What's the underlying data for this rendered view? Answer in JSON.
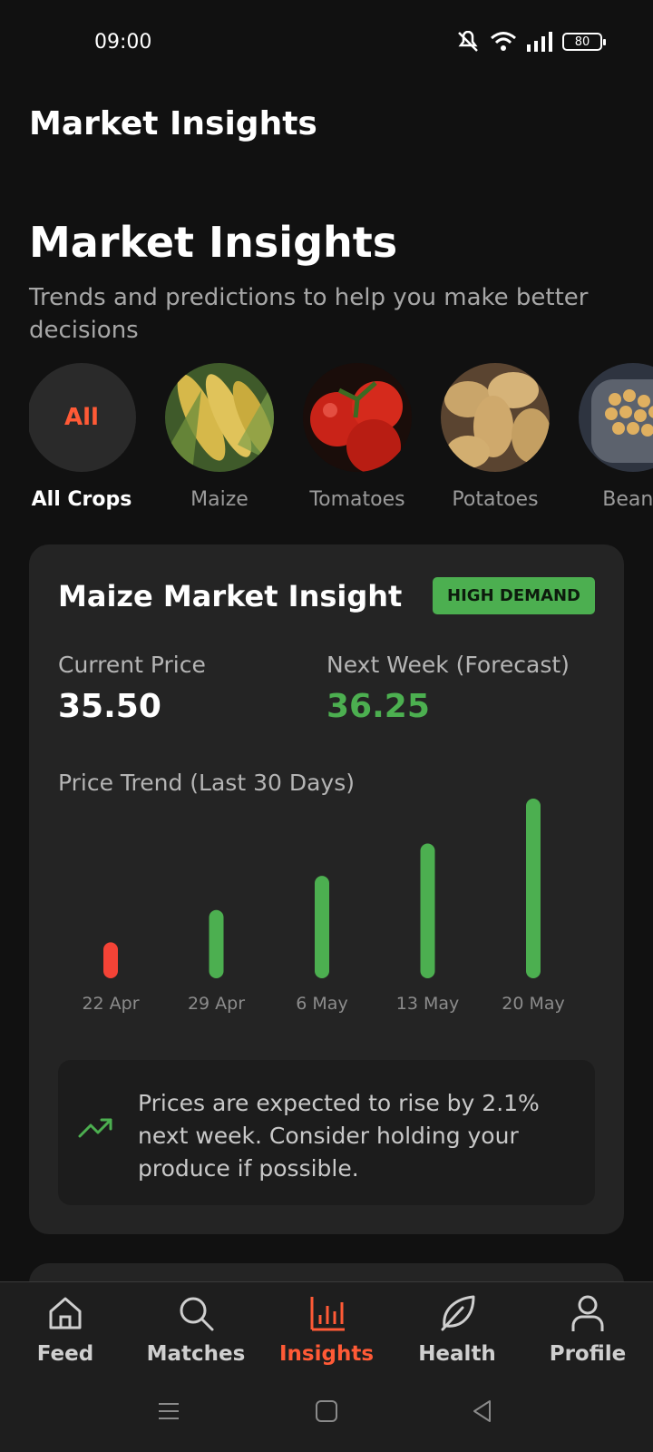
{
  "status": {
    "time": "09:00",
    "battery": "80"
  },
  "app_title": "Market Insights",
  "hero": {
    "title": "Market Insights",
    "subtitle": "Trends and predictions to help you make better decisions"
  },
  "crops": [
    {
      "label": "All Crops",
      "badge": "All",
      "active": true
    },
    {
      "label": "Maize"
    },
    {
      "label": "Tomatoes"
    },
    {
      "label": "Potatoes"
    },
    {
      "label": "Beans"
    }
  ],
  "card": {
    "title": "Maize Market Insight",
    "badge": "HIGH DEMAND",
    "current_label": "Current Price",
    "current_value": "35.50",
    "forecast_label": "Next Week (Forecast)",
    "forecast_value": "36.25",
    "trend_label": "Price Trend (Last 30 Days)",
    "note": "Prices are expected to rise by 2.1% next week. Consider holding your produce if possible."
  },
  "chart_data": {
    "type": "bar",
    "categories": [
      "22 Apr",
      "29 Apr",
      "6 May",
      "13 May",
      "20 May"
    ],
    "values": [
      0.2,
      0.38,
      0.57,
      0.75,
      1.0
    ],
    "colors": [
      "#f44336",
      "#4caf50",
      "#4caf50",
      "#4caf50",
      "#4caf50"
    ]
  },
  "colors": {
    "accent": "#ff5a36",
    "positive": "#4caf50",
    "negative": "#f44336"
  },
  "nav": {
    "items": [
      {
        "label": "Feed",
        "icon": "home-icon"
      },
      {
        "label": "Matches",
        "icon": "search-icon"
      },
      {
        "label": "Insights",
        "icon": "bar-chart-icon",
        "active": true
      },
      {
        "label": "Health",
        "icon": "leaf-icon"
      },
      {
        "label": "Profile",
        "icon": "person-icon"
      }
    ]
  }
}
